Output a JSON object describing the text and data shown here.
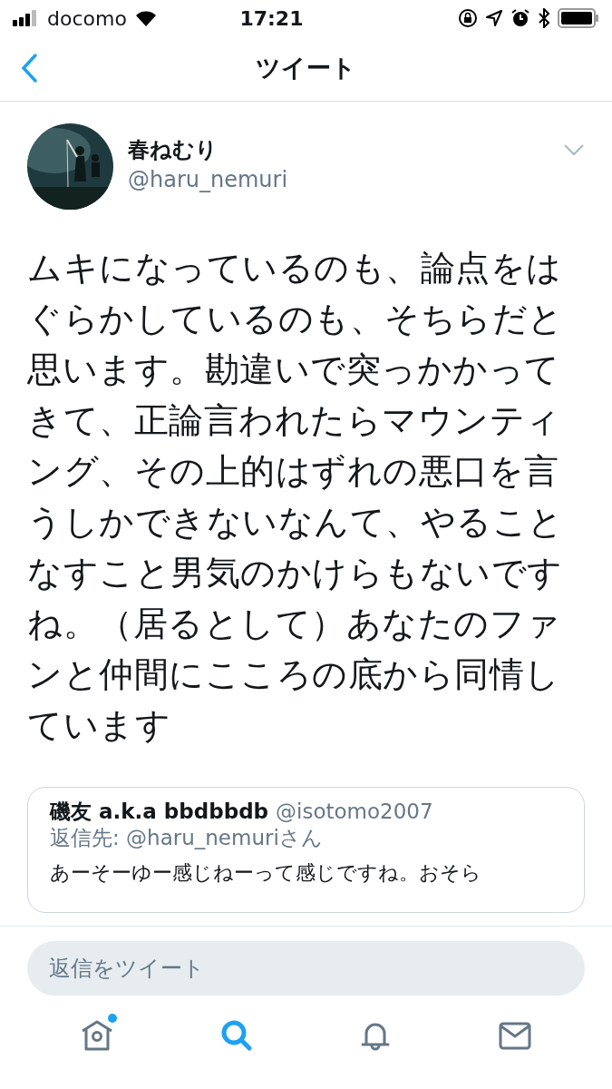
{
  "status_bar": {
    "carrier": "docomo",
    "time": "17:21"
  },
  "nav": {
    "title": "ツイート"
  },
  "tweet": {
    "author": {
      "name": "春ねむり",
      "handle": "@haru_nemuri"
    },
    "text": "ムキになっているのも、論点をはぐらかしているのも、そちらだと思います。勘違いで突っかかってきて、正論言われたらマウンティング、その上的はずれの悪口を言うしかできないなんて、やることなすこと男気のかけらもないですね。（居るとして）あなたのファンと仲間にこころの底から同情しています",
    "quoted": {
      "name": "磯友 a.k.a bbdbbdb",
      "handle": "@isotomo2007",
      "reply_to_label": "返信先: ",
      "reply_to": "@haru_nemuri",
      "reply_to_suffix": "さん",
      "text": "あーそーゆー感じねーって感じですね。おそら"
    }
  },
  "reply": {
    "placeholder": "返信をツイート"
  },
  "tab_bar": [
    {
      "kind": "home",
      "selected": false,
      "badge": true
    },
    {
      "kind": "search",
      "selected": true,
      "badge": false
    },
    {
      "kind": "notifications",
      "selected": false,
      "badge": false
    },
    {
      "kind": "messages",
      "selected": false,
      "badge": false
    }
  ]
}
